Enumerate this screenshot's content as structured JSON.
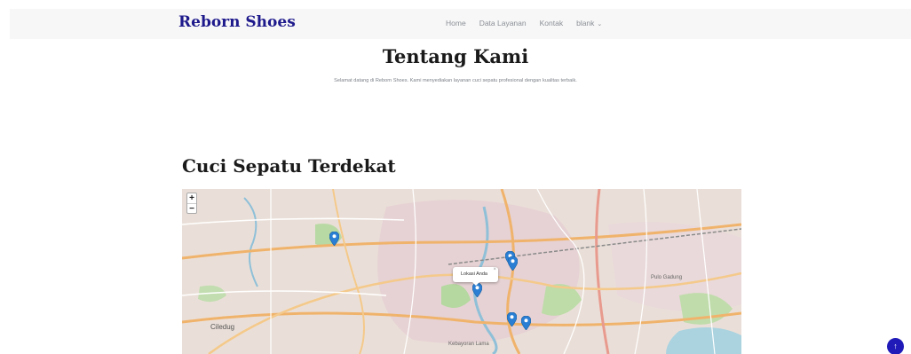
{
  "navbar": {
    "brand": "Reborn Shoes",
    "links": [
      "Home",
      "Data Layanan",
      "Kontak",
      "blank"
    ],
    "dropdown_icon": "chevron-down-icon"
  },
  "about": {
    "title": "Tentang Kami",
    "text": "Selamat datang di Reborn Shoes. Kami menyediakan layanan cuci sepatu profesional dengan kualitas terbaik."
  },
  "nearby": {
    "title": "Cuci Sepatu Terdekat",
    "map": {
      "zoom_in": "+",
      "zoom_out": "−",
      "popup_text": "Lokasi Anda",
      "popup_close": "×",
      "labels": {
        "city_left": "Ciledug",
        "city_bottom": "Kebayoran Lama",
        "district_right": "Pulo Gadung"
      },
      "marker_icon": "map-pin-icon"
    }
  },
  "back_to_top": {
    "icon": "arrow-up-icon",
    "glyph": "↑"
  },
  "colors": {
    "brand": "#1e1a8c",
    "accent": "#1f1ab8",
    "marker": "#2a7fd4"
  }
}
